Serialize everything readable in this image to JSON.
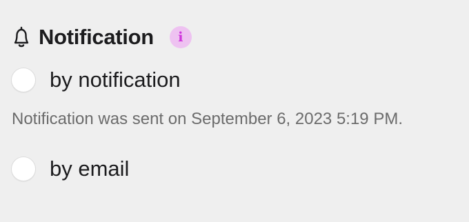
{
  "section": {
    "title": "Notification",
    "icon": "bell-icon",
    "info_icon": "info-icon",
    "info_glyph": "i",
    "accent_color": "#cf34dc",
    "accent_bg": "#eec2f1"
  },
  "options": [
    {
      "label": "by notification",
      "checked": false
    },
    {
      "label": "by email",
      "checked": false
    }
  ],
  "status_text": "Notification was sent on September 6, 2023 5:19 PM."
}
